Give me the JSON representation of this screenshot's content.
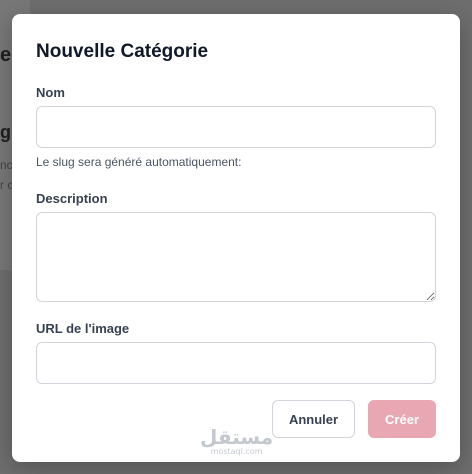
{
  "background": {
    "title_fragment": "es",
    "subtitle_fragment": "g",
    "line1_fragment": "nc",
    "line2_fragment": "r c"
  },
  "modal": {
    "title": "Nouvelle Catégorie",
    "fields": {
      "name": {
        "label": "Nom",
        "value": "",
        "placeholder": "",
        "helper": "Le slug sera généré automatiquement:"
      },
      "description": {
        "label": "Description",
        "value": "",
        "placeholder": ""
      },
      "image_url": {
        "label": "URL de l'image",
        "value": "",
        "placeholder": ""
      }
    },
    "buttons": {
      "cancel_label": "Annuler",
      "create_label": "Créer"
    }
  },
  "watermark": {
    "main": "مستقل",
    "sub": "mostaql.com"
  },
  "colors": {
    "overlay": "#6f6f6f",
    "create_button": "#e8a7b3",
    "title_text": "#111827",
    "input_border": "#d1d5db"
  }
}
